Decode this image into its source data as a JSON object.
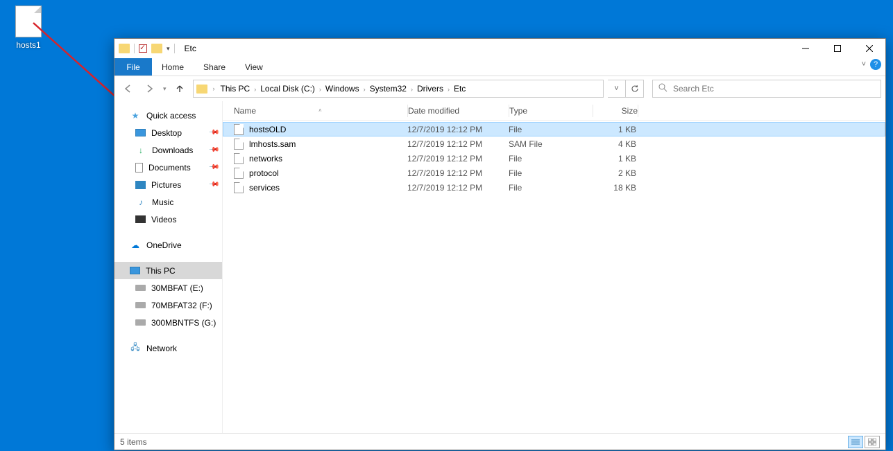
{
  "desktop": {
    "file_label": "hosts1"
  },
  "window": {
    "title": "Etc",
    "tabs": {
      "file": "File",
      "home": "Home",
      "share": "Share",
      "view": "View"
    },
    "nav": {
      "breadcrumbs": [
        "This PC",
        "Local Disk (C:)",
        "Windows",
        "System32",
        "Drivers",
        "Etc"
      ],
      "search_placeholder": "Search Etc"
    },
    "sidebar": {
      "quick_access": "Quick access",
      "items_qa": [
        {
          "label": "Desktop",
          "pinned": true
        },
        {
          "label": "Downloads",
          "pinned": true
        },
        {
          "label": "Documents",
          "pinned": true
        },
        {
          "label": "Pictures",
          "pinned": true
        },
        {
          "label": "Music",
          "pinned": false
        },
        {
          "label": "Videos",
          "pinned": false
        }
      ],
      "onedrive": "OneDrive",
      "this_pc": "This PC",
      "drives": [
        {
          "label": "30MBFAT (E:)"
        },
        {
          "label": "70MBFAT32 (F:)"
        },
        {
          "label": "300MBNTFS (G:)"
        }
      ],
      "network": "Network"
    },
    "columns": {
      "name": "Name",
      "date": "Date modified",
      "type": "Type",
      "size": "Size"
    },
    "files": [
      {
        "name": "hostsOLD",
        "date": "12/7/2019 12:12 PM",
        "type": "File",
        "size": "1 KB",
        "selected": true
      },
      {
        "name": "lmhosts.sam",
        "date": "12/7/2019 12:12 PM",
        "type": "SAM File",
        "size": "4 KB",
        "selected": false
      },
      {
        "name": "networks",
        "date": "12/7/2019 12:12 PM",
        "type": "File",
        "size": "1 KB",
        "selected": false
      },
      {
        "name": "protocol",
        "date": "12/7/2019 12:12 PM",
        "type": "File",
        "size": "2 KB",
        "selected": false
      },
      {
        "name": "services",
        "date": "12/7/2019 12:12 PM",
        "type": "File",
        "size": "18 KB",
        "selected": false
      }
    ],
    "status": "5 items"
  }
}
